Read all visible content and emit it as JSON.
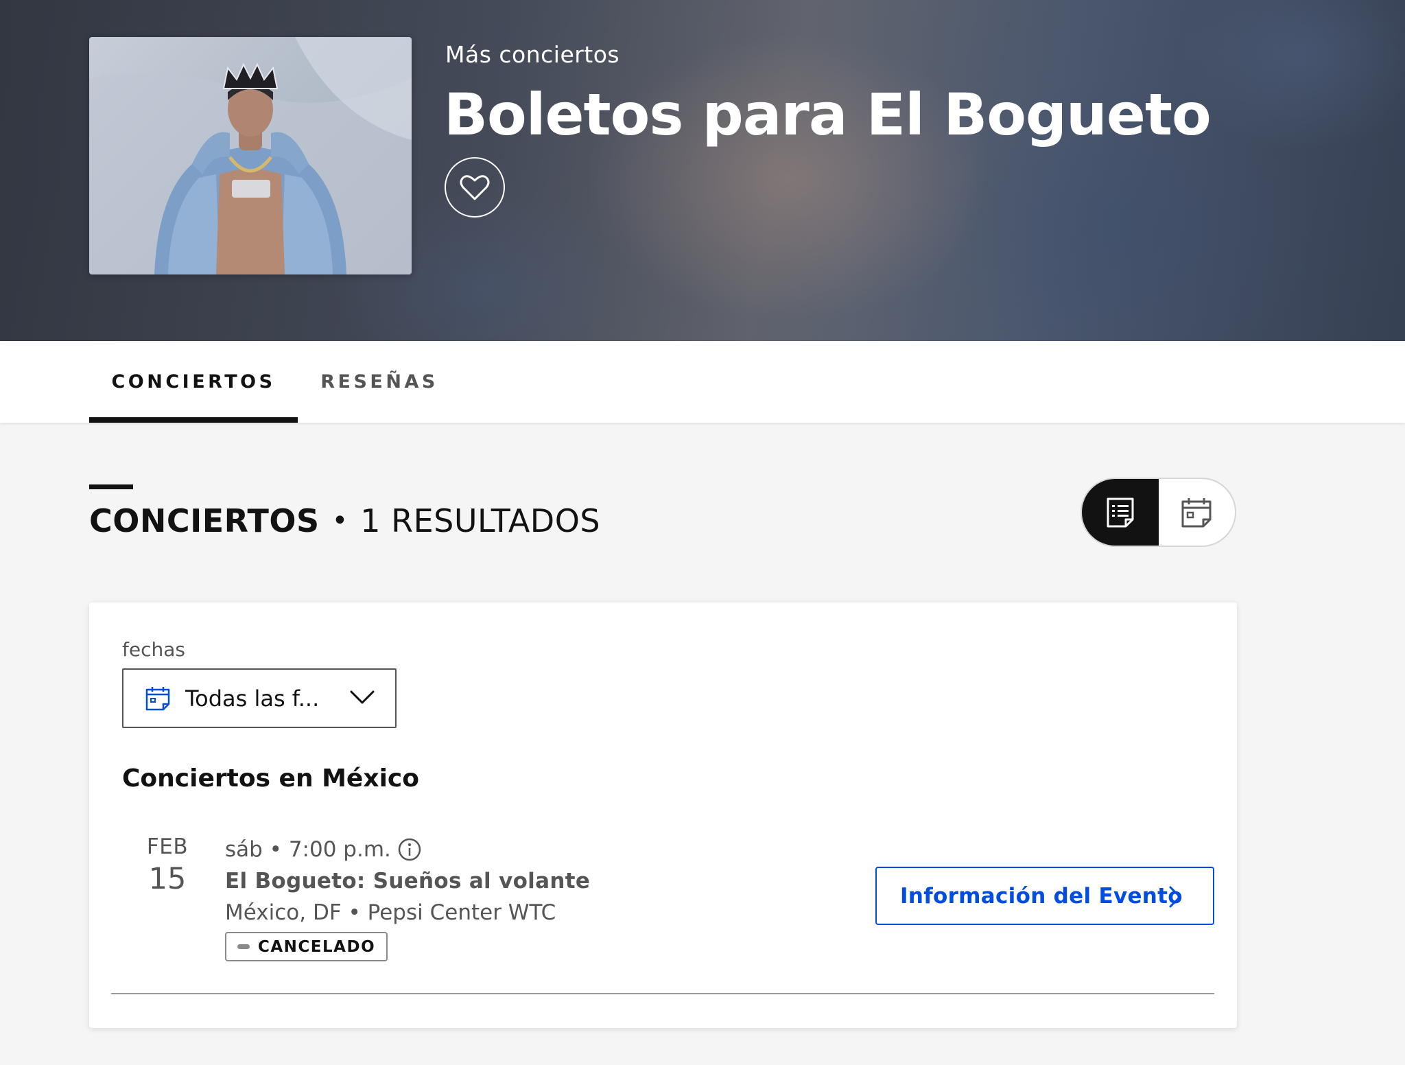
{
  "hero": {
    "kicker": "Más conciertos",
    "title": "Boletos para El Bogueto",
    "favorite_icon": "heart-icon"
  },
  "tabs": [
    {
      "label": "CONCIERTOS",
      "active": true
    },
    {
      "label": "RESEÑAS",
      "active": false
    }
  ],
  "section": {
    "title": "CONCIERTOS",
    "separator": "•",
    "count_label": "1 RESULTADOS",
    "view_modes": [
      {
        "icon": "list-view-icon",
        "active": true
      },
      {
        "icon": "calendar-view-icon",
        "active": false
      }
    ]
  },
  "filters": {
    "dates_label": "fechas",
    "dates_value": "Todas las f..."
  },
  "country_heading": "Conciertos en México",
  "events": [
    {
      "month": "FEB",
      "day": "15",
      "time": "sáb • 7:00 p.m.",
      "name": "El Bogueto: Sueños al volante",
      "venue": "México, DF • Pepsi Center WTC",
      "status": "CANCELADO",
      "button_label": "Información del Evento"
    }
  ],
  "colors": {
    "accent": "#024ddf",
    "text_primary": "#121212",
    "text_secondary": "#555555",
    "page_background": "#f5f5f5"
  }
}
